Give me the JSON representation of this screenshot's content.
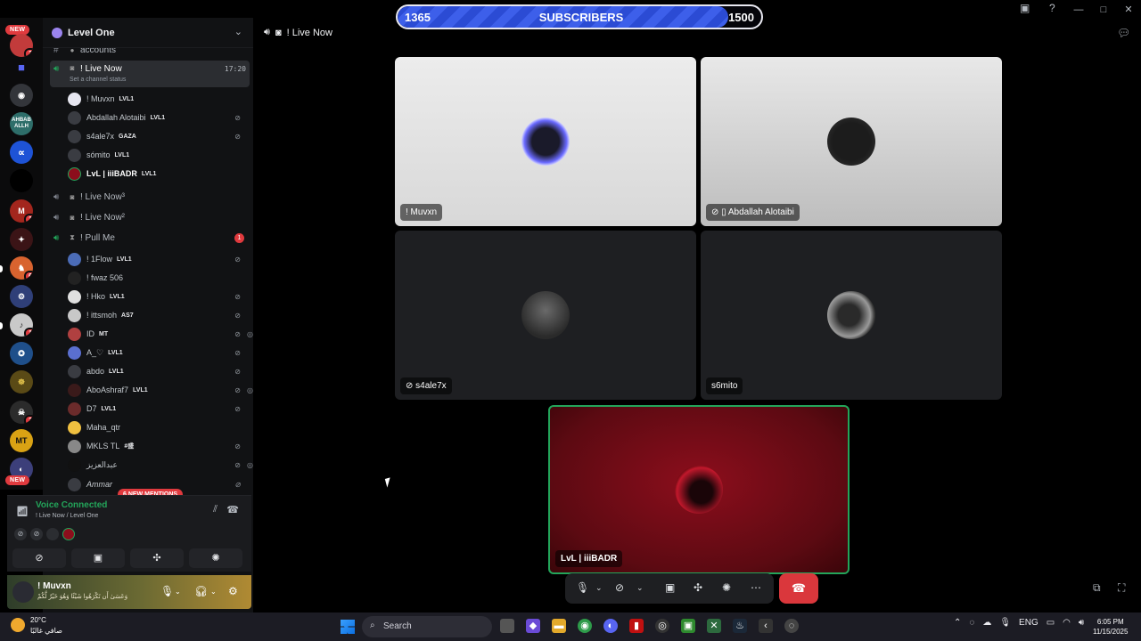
{
  "server": {
    "name": "Level One"
  },
  "top_channel": {
    "label": "accounts"
  },
  "live_channel": {
    "label": "! Live Now",
    "time": "17:20",
    "status": "Set a channel status"
  },
  "live_members": [
    {
      "name": "! Muvxn",
      "tag": "LVL1"
    },
    {
      "name": "Abdallah Alotaibi",
      "tag": "LVL1"
    },
    {
      "name": "s4ale7x",
      "tag": "GAZA"
    },
    {
      "name": "sómito",
      "tag": "LVL1"
    },
    {
      "name": "LvL | iiiBADR",
      "tag": "LVL1"
    }
  ],
  "other_channels": [
    {
      "label": "! Live Now³"
    },
    {
      "label": "! Live Now²"
    },
    {
      "label": "! Pull Me",
      "badge": "1"
    }
  ],
  "pull_members": [
    {
      "name": "! 1Flow",
      "tag": "LVL1"
    },
    {
      "name": "! fwaz 506",
      "tag": ""
    },
    {
      "name": "! Hko",
      "tag": "LVL1"
    },
    {
      "name": "! ittsmoh",
      "tag": "AS7"
    },
    {
      "name": "ID",
      "tag": "MT"
    },
    {
      "name": "A_♡",
      "tag": "LVL1"
    },
    {
      "name": "abdo",
      "tag": "LVL1"
    },
    {
      "name": "AboAshraf7",
      "tag": "LVL1"
    },
    {
      "name": "D7",
      "tag": "LVL1"
    },
    {
      "name": "Maha_qtr",
      "tag": ""
    },
    {
      "name": "MKLS TL",
      "tag": "#盛"
    },
    {
      "name": "عبدالعزيز",
      "tag": ""
    },
    {
      "name": "Ammar",
      "tag": ""
    }
  ],
  "mentions_pill": "6 NEW MENTIONS",
  "rail": {
    "new_label": "NEW",
    "badges": [
      "3",
      "1",
      "6",
      "1",
      "2"
    ],
    "texts": [
      "AHBAB ALLH",
      "MT"
    ]
  },
  "voice": {
    "title": "Voice Connected",
    "subtitle": "! Live Now / Level One"
  },
  "user": {
    "name": "! Muvxn",
    "status": "وَعَسَىٰ أَن تَكْرَهُوا شَيْئًا وَهُوَ خَيْرٌ لَّكُمْ"
  },
  "channel_title": "! Live Now",
  "subscribers": {
    "current": "1365",
    "label": "SUBSCRIBERS",
    "goal": "1500",
    "progress": 0.91
  },
  "tiles": [
    {
      "name": "! Muvxn"
    },
    {
      "name": "Abdallah Alotaibi"
    },
    {
      "name": "s4ale7x"
    },
    {
      "name": "s6mito"
    },
    {
      "name": "LvL | iiiBADR"
    }
  ],
  "taskbar": {
    "temp": "20°C",
    "weather": "صافي غالبًا",
    "search": "Search",
    "lang": "ENG",
    "time": "6:05 PM",
    "date": "11/15/2025"
  },
  "colors": {
    "accent_green": "#23a55a",
    "danger_red": "#da373c",
    "progress_blue": "#2b4bd4"
  }
}
